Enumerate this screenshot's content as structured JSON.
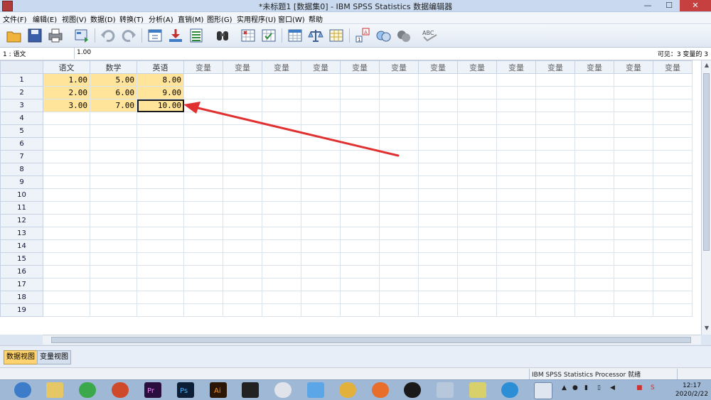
{
  "window": {
    "title": "*未标题1 [数据集0] - IBM SPSS Statistics 数据编辑器",
    "controls": [
      "—",
      "☐",
      "✕"
    ]
  },
  "menu": [
    "文件(F)",
    "编辑(E)",
    "视图(V)",
    "数据(D)",
    "转换(T)",
    "分析(A)",
    "直销(M)",
    "图形(G)",
    "实用程序(U)",
    "窗口(W)",
    "帮助"
  ],
  "toolbar_icons": [
    "open-icon",
    "save-icon",
    "print-icon",
    "dialog-recall-icon",
    "undo-icon",
    "redo-icon",
    "goto-case-icon",
    "goto-variable-icon",
    "variables-icon",
    "find-icon",
    "insert-cases-icon",
    "insert-variable-icon",
    "split-file-icon",
    "weight-cases-icon",
    "select-cases-icon",
    "value-labels-icon",
    "use-sets-icon",
    "show-all-icon",
    "spelling-icon"
  ],
  "cellbar": {
    "reference": "1 : 语文",
    "value": "1.00",
    "visible": "可见：3 变量的 3"
  },
  "grid": {
    "columns": [
      "语文",
      "数学",
      "英语",
      "变量",
      "变量",
      "变量",
      "变量",
      "变量",
      "变量",
      "变量",
      "变量",
      "变量",
      "变量",
      "变量",
      "变量",
      "变量"
    ],
    "rows": [
      [
        "1.00",
        "5.00",
        "8.00"
      ],
      [
        "2.00",
        "6.00",
        "9.00"
      ],
      [
        "3.00",
        "7.00",
        "10.00"
      ]
    ],
    "row_numbers": [
      "1",
      "2",
      "3",
      "4",
      "5",
      "6",
      "7",
      "8",
      "9",
      "10",
      "11",
      "12",
      "13",
      "14",
      "15",
      "16",
      "17",
      "18",
      "19"
    ],
    "active_cell": {
      "row": 3,
      "column": "英语"
    }
  },
  "tabs": [
    "数据视图",
    "变量视图"
  ],
  "status": {
    "processor": "IBM SPSS Statistics Processor 就绪"
  },
  "taskbar": {
    "apps": [
      "app-icon-1",
      "file-explorer-icon",
      "wechat-icon",
      "powerpoint-icon",
      "premiere-icon",
      "photoshop-icon",
      "illustrator-icon",
      "video-editor-icon",
      "app-icon-2",
      "app-icon-3",
      "chrome-icon",
      "app-icon-4",
      "qq-icon",
      "app-icon-5",
      "app-icon-6",
      "ie-icon",
      "spss-icon"
    ],
    "time": "12:17",
    "date": "2020/2/22"
  },
  "colors": {
    "active_tab": "#ffd470",
    "filled_cell": "#ffe49a",
    "annotation_arrow": "#e03030"
  }
}
